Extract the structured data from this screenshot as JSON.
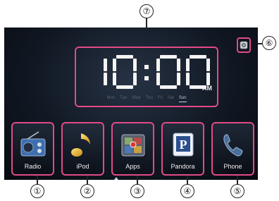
{
  "screen": {
    "clock": {
      "time": "10:00",
      "ampm": "AM",
      "weekdays": [
        "Mon",
        "Tue",
        "Wed",
        "Thu",
        "Fri",
        "Sat",
        "Sun"
      ],
      "active_day": "Sun"
    },
    "apps": [
      {
        "label": "Radio",
        "icon": "radio-icon"
      },
      {
        "label": "iPod",
        "icon": "music-note-icon"
      },
      {
        "label": "Apps",
        "icon": "apps-icon"
      },
      {
        "label": "Pandora",
        "icon": "pandora-icon"
      },
      {
        "label": "Phone",
        "icon": "phone-icon"
      }
    ],
    "settings_icon": "settings-icon",
    "highlight_color": "#e24a86"
  },
  "callouts": [
    "①",
    "②",
    "③",
    "④",
    "⑤",
    "⑥",
    "⑦"
  ]
}
